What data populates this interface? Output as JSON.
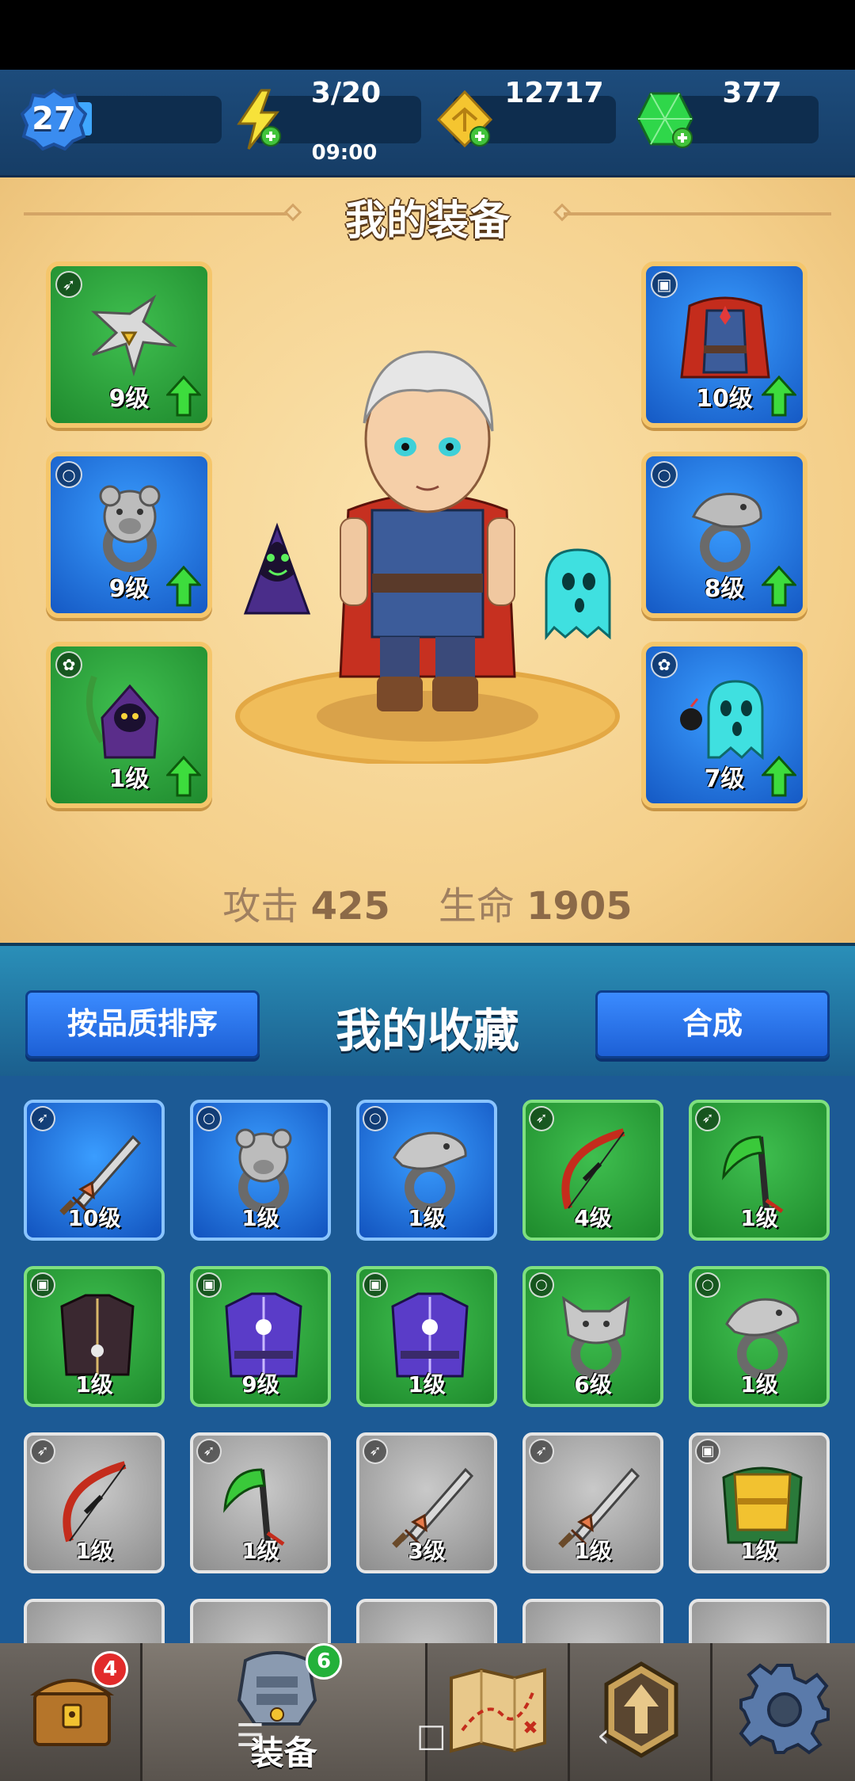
{
  "resources": {
    "level": "27",
    "energy": "3/20",
    "energy_timer": "09:00",
    "gold": "12717",
    "gems": "377"
  },
  "equipment": {
    "title": "我的装备",
    "slots": [
      {
        "level": "9级",
        "rarity": "green",
        "type_icon": "bow-icon",
        "item": "shuriken"
      },
      {
        "level": "9级",
        "rarity": "blue",
        "type_icon": "ring-icon",
        "item": "bear-ring"
      },
      {
        "level": "1级",
        "rarity": "green",
        "type_icon": "paw-icon",
        "item": "reaper-pet"
      },
      {
        "level": "10级",
        "rarity": "blue",
        "type_icon": "armor-icon",
        "item": "cape-armor"
      },
      {
        "level": "8级",
        "rarity": "blue",
        "type_icon": "ring-icon",
        "item": "serpent-ring"
      },
      {
        "level": "7级",
        "rarity": "blue",
        "type_icon": "paw-icon",
        "item": "ghost-pet"
      }
    ],
    "stats": {
      "attack_label": "攻击",
      "attack_value": "425",
      "hp_label": "生命",
      "hp_value": "1905"
    }
  },
  "collection": {
    "title": "我的收藏",
    "sort_button": "按品质排序",
    "merge_button": "合成",
    "items": [
      {
        "level": "10级",
        "rarity": "blue",
        "type_icon": "bow-icon",
        "item": "sword"
      },
      {
        "level": "1级",
        "rarity": "blue",
        "type_icon": "ring-icon",
        "item": "bear-ring"
      },
      {
        "level": "1级",
        "rarity": "blue",
        "type_icon": "ring-icon",
        "item": "eagle-ring"
      },
      {
        "level": "4级",
        "rarity": "green",
        "type_icon": "bow-icon",
        "item": "bow"
      },
      {
        "level": "1级",
        "rarity": "green",
        "type_icon": "bow-icon",
        "item": "scythe"
      },
      {
        "level": "1级",
        "rarity": "green",
        "type_icon": "armor-icon",
        "item": "dark-robe"
      },
      {
        "level": "9级",
        "rarity": "green",
        "type_icon": "armor-icon",
        "item": "purple-robe"
      },
      {
        "level": "1级",
        "rarity": "green",
        "type_icon": "armor-icon",
        "item": "purple-robe"
      },
      {
        "level": "6级",
        "rarity": "green",
        "type_icon": "ring-icon",
        "item": "wolf-ring"
      },
      {
        "level": "1级",
        "rarity": "green",
        "type_icon": "ring-icon",
        "item": "eagle-ring"
      },
      {
        "level": "1级",
        "rarity": "gray",
        "type_icon": "bow-icon",
        "item": "bow"
      },
      {
        "level": "1级",
        "rarity": "gray",
        "type_icon": "bow-icon",
        "item": "scythe"
      },
      {
        "level": "3级",
        "rarity": "gray",
        "type_icon": "bow-icon",
        "item": "sword"
      },
      {
        "level": "1级",
        "rarity": "gray",
        "type_icon": "bow-icon",
        "item": "sword"
      },
      {
        "level": "1级",
        "rarity": "gray",
        "type_icon": "armor-icon",
        "item": "gold-armor"
      }
    ]
  },
  "nav": {
    "chest_badge": "4",
    "equip_badge": "6",
    "equip_label": "装备"
  }
}
